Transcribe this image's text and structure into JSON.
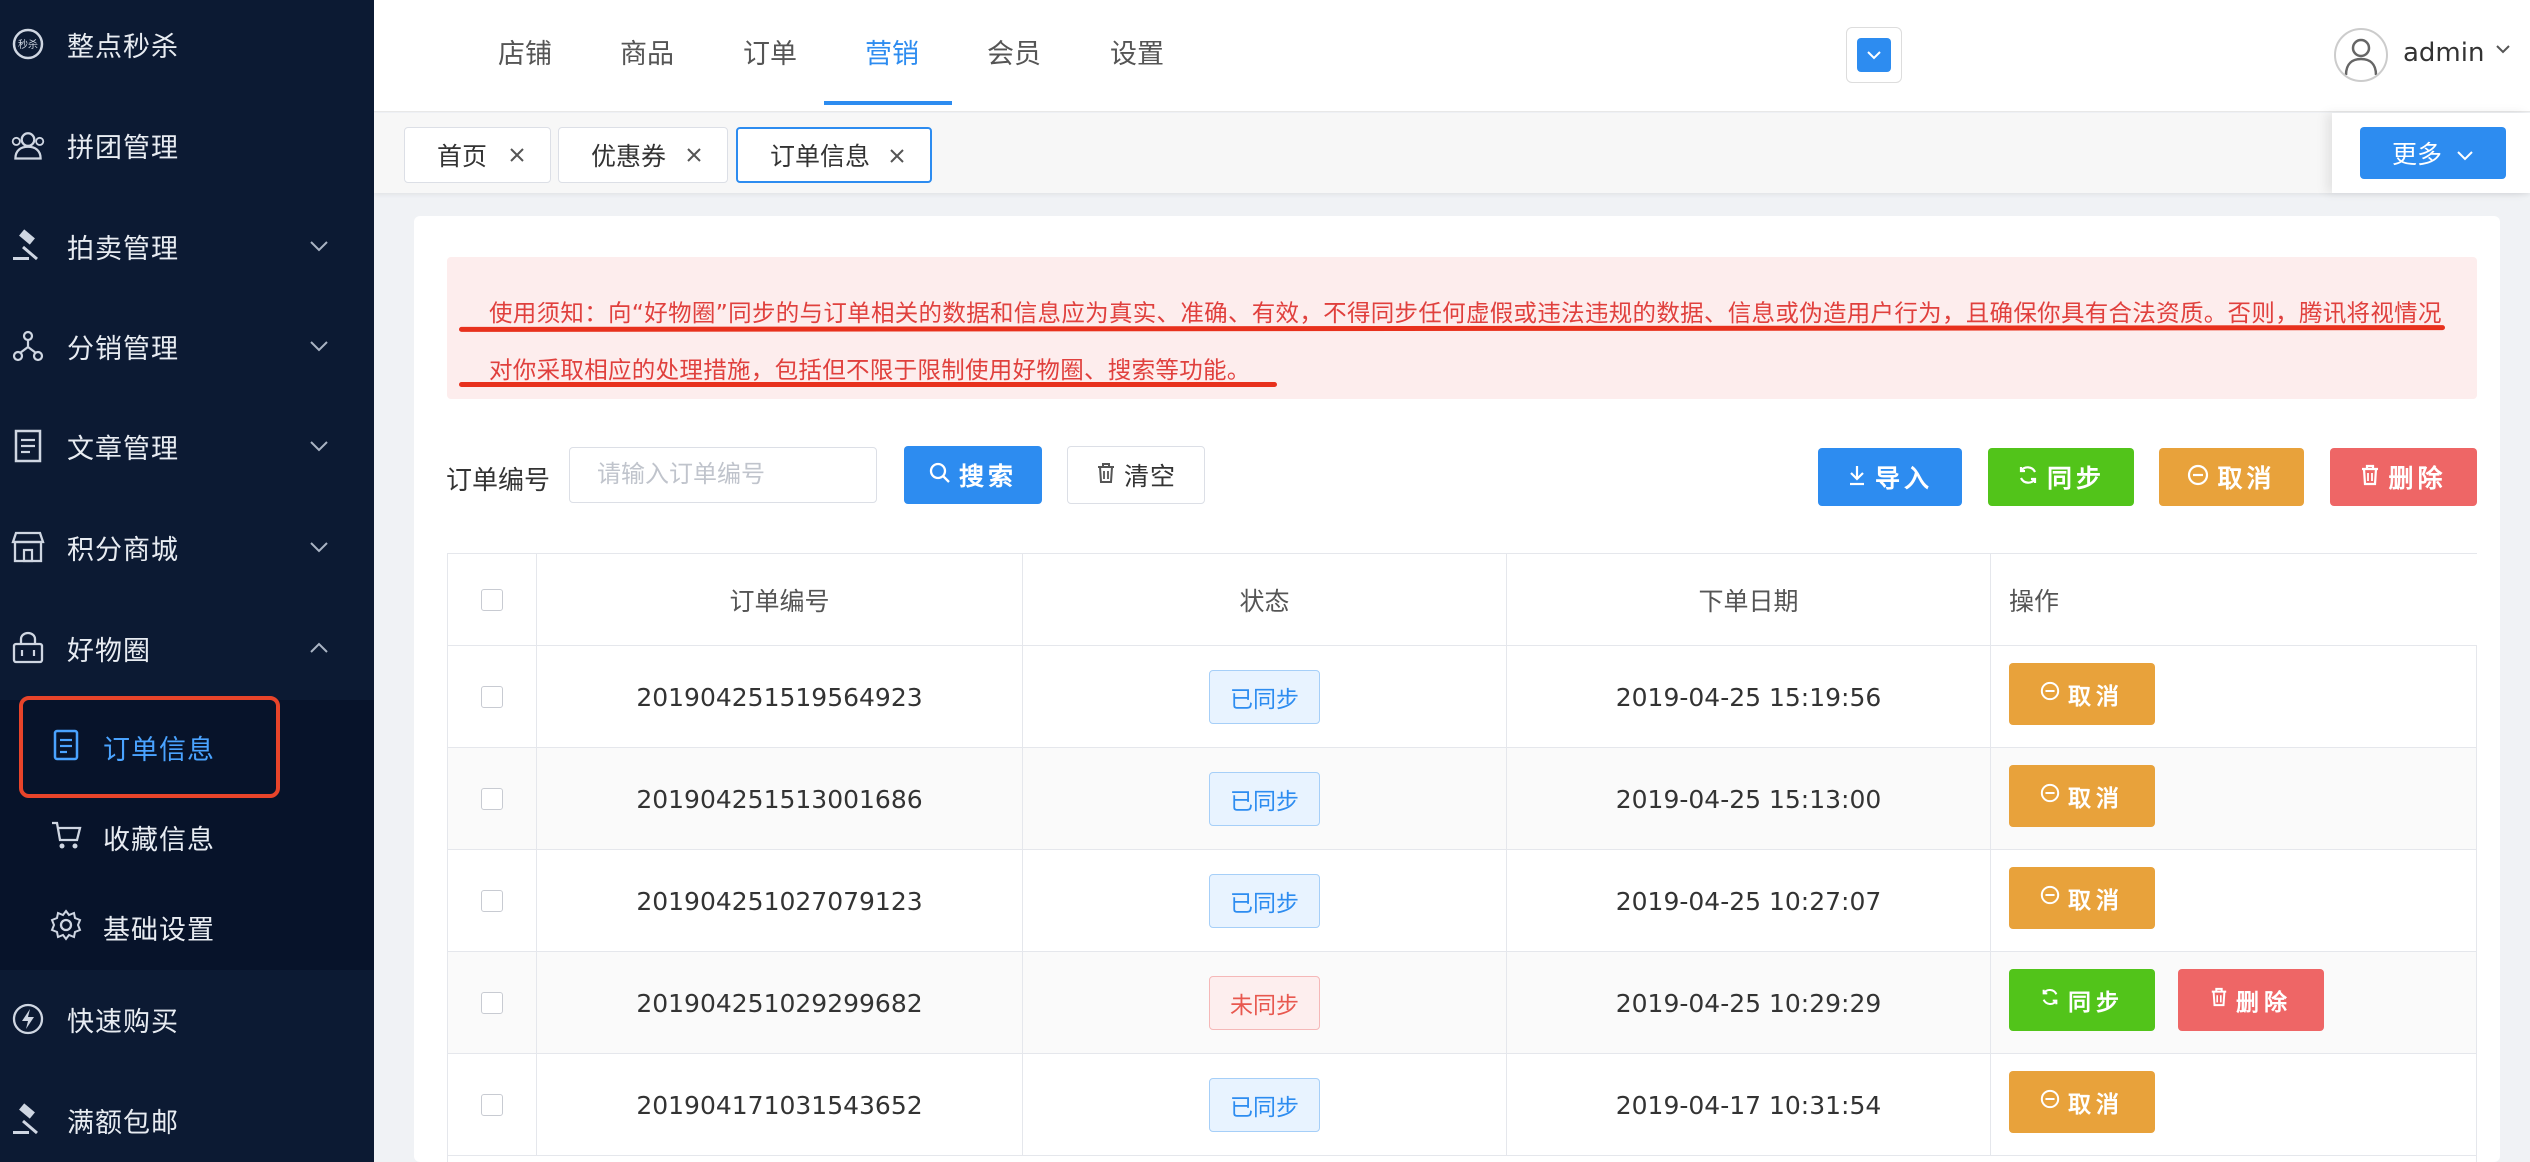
{
  "sidebar": {
    "items": [
      {
        "label": "整点秒杀",
        "icon": "flash-sale-icon",
        "has_arrow": false
      },
      {
        "label": "拼团管理",
        "icon": "group-icon",
        "has_arrow": false
      },
      {
        "label": "拍卖管理",
        "icon": "gavel-icon",
        "has_arrow": true
      },
      {
        "label": "分销管理",
        "icon": "network-icon",
        "has_arrow": true
      },
      {
        "label": "文章管理",
        "icon": "article-icon",
        "has_arrow": true
      },
      {
        "label": "积分商城",
        "icon": "store-icon",
        "has_arrow": true
      },
      {
        "label": "好物圈",
        "icon": "basket-icon",
        "has_arrow": true,
        "expanded": true
      },
      {
        "label": "快速购买",
        "icon": "bolt-icon",
        "has_arrow": false
      },
      {
        "label": "满额包邮",
        "icon": "hammer-icon",
        "has_arrow": false
      }
    ],
    "submenu": [
      {
        "label": "订单信息",
        "icon": "document-icon",
        "active": true
      },
      {
        "label": "收藏信息",
        "icon": "cart-icon",
        "active": false
      },
      {
        "label": "基础设置",
        "icon": "gear-icon",
        "active": false
      }
    ]
  },
  "topnav": {
    "tabs": [
      "店铺",
      "商品",
      "订单",
      "营销",
      "会员",
      "设置"
    ],
    "active": "营销",
    "user": "admin"
  },
  "page_tabs": {
    "tabs": [
      "首页",
      "优惠券",
      "订单信息"
    ],
    "active": "订单信息",
    "more_label": "更多"
  },
  "notice": {
    "text": "使用须知：向“好物圈”同步的与订单相关的数据和信息应为真实、准确、有效，不得同步任何虚假或违法违规的数据、信息或伪造用户行为，且确保你具有合法资质。否则，腾讯将视情况对你采取相应的处理措施，包括但不限于限制使用好物圈、搜索等功能。"
  },
  "search": {
    "label": "订单编号",
    "placeholder": "请输入订单编号",
    "value": "",
    "search_label": "搜索",
    "clear_label": "清空"
  },
  "actions": {
    "import_label": "导入",
    "sync_label": "同步",
    "cancel_label": "取消",
    "delete_label": "删除"
  },
  "table": {
    "headers": [
      "订单编号",
      "状态",
      "下单日期",
      "操作"
    ],
    "rows": [
      {
        "order_no": "201904251519564923",
        "status": "已同步",
        "synced": true,
        "date": "2019-04-25 15:19:56",
        "ops": [
          "取消"
        ]
      },
      {
        "order_no": "201904251513001686",
        "status": "已同步",
        "synced": true,
        "date": "2019-04-25 15:13:00",
        "ops": [
          "取消"
        ]
      },
      {
        "order_no": "201904251027079123",
        "status": "已同步",
        "synced": true,
        "date": "2019-04-25 10:27:07",
        "ops": [
          "取消"
        ]
      },
      {
        "order_no": "201904251029299682",
        "status": "未同步",
        "synced": false,
        "date": "2019-04-25 10:29:29",
        "ops": [
          "同步",
          "删除"
        ]
      },
      {
        "order_no": "201904171031543652",
        "status": "已同步",
        "synced": true,
        "date": "2019-04-17 10:31:54",
        "ops": [
          "取消"
        ]
      }
    ]
  },
  "colors": {
    "sidebar_bg": "#0c1a33",
    "primary": "#2d8cf0",
    "success": "#52c41a",
    "warning": "#e8a23b",
    "danger": "#ee6666",
    "highlight": "#e8311d"
  }
}
